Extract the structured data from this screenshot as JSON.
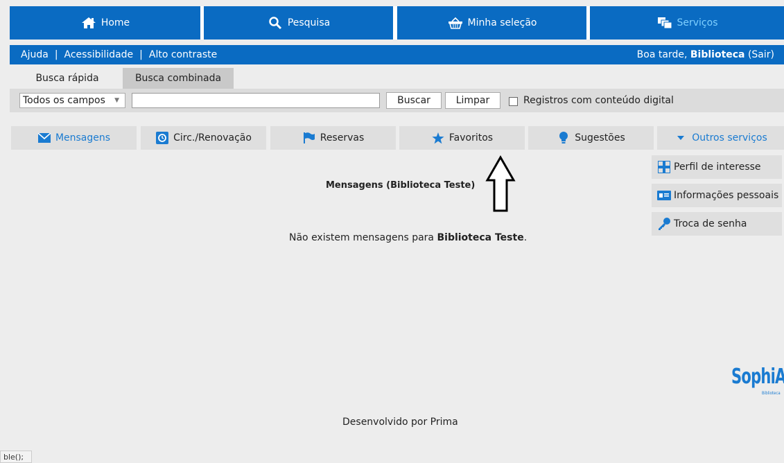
{
  "top_nav": [
    {
      "label": "Home",
      "icon": "home-icon"
    },
    {
      "label": "Pesquisa",
      "icon": "search-icon"
    },
    {
      "label": "Minha seleção",
      "icon": "basket-icon"
    },
    {
      "label": "Serviços",
      "icon": "services-icon"
    }
  ],
  "sub_nav": {
    "links": [
      "Ajuda",
      "Acessibilidade",
      "Alto contraste"
    ],
    "separator": "|",
    "greeting": "Boa tarde,",
    "user": "Biblioteca",
    "logout": "(Sair)"
  },
  "search_tabs": [
    "Busca rápida",
    "Busca combinada"
  ],
  "search": {
    "field_select": "Todos os campos",
    "query_value": "",
    "buscar_label": "Buscar",
    "limpar_label": "Limpar",
    "digital_label": "Registros com conteúdo digital",
    "digital_checked": false
  },
  "services": [
    {
      "label": "Mensagens",
      "icon": "envelope-icon"
    },
    {
      "label": "Circ./Renovação",
      "icon": "circulation-icon"
    },
    {
      "label": "Reservas",
      "icon": "flag-icon"
    },
    {
      "label": "Favoritos",
      "icon": "star-icon"
    },
    {
      "label": "Sugestões",
      "icon": "lightbulb-icon"
    },
    {
      "label": "Outros serviços",
      "icon": "caret-down-icon"
    }
  ],
  "other_services": [
    {
      "label": "Perfil de interesse",
      "icon": "grid-icon"
    },
    {
      "label": "Informações pessoais",
      "icon": "id-card-icon"
    },
    {
      "label": "Troca de senha",
      "icon": "key-icon"
    }
  ],
  "content": {
    "title": "Mensagens (Biblioteca Teste)",
    "message_prefix": "Não existem mensagens para",
    "message_name": "Biblioteca Teste",
    "message_suffix": "."
  },
  "logo": {
    "text": "SophiA",
    "sub": "Biblioteca"
  },
  "footer": "Desenvolvido por Prima",
  "corner_text": "ble();",
  "colors": {
    "primary": "#0a6bc2",
    "accent": "#1a7bd1",
    "active_nav_text": "#7fd0ff"
  }
}
